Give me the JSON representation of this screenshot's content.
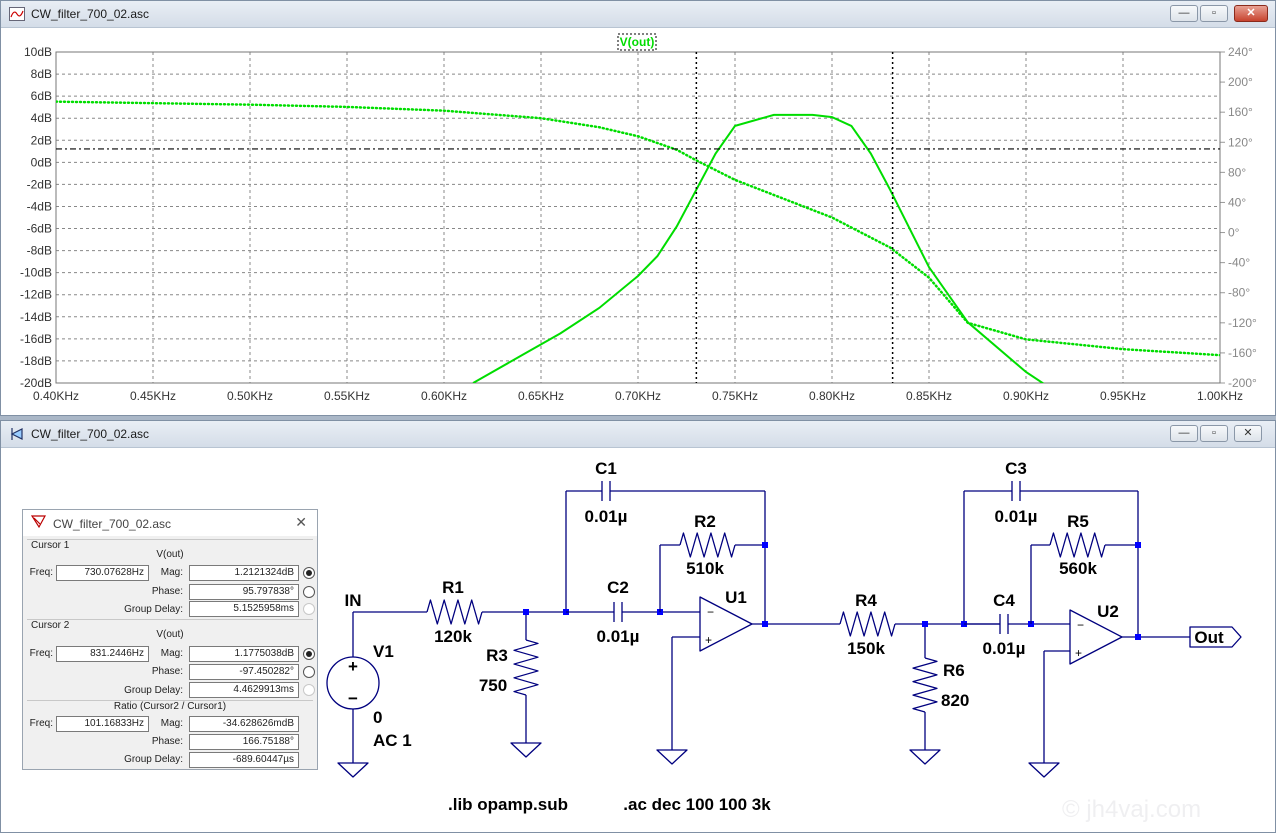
{
  "plot_window": {
    "title": "CW_filter_700_02.asc",
    "trace_label": "V(out)",
    "colors": {
      "trace": "#00dd00",
      "cursor": "#000000"
    },
    "chart_data": {
      "type": "line",
      "x_unit": "KHz",
      "xlim": [
        0.4,
        1.0
      ],
      "x_ticks": [
        "0.40KHz",
        "0.45KHz",
        "0.50KHz",
        "0.55KHz",
        "0.60KHz",
        "0.65KHz",
        "0.70KHz",
        "0.75KHz",
        "0.80KHz",
        "0.85KHz",
        "0.90KHz",
        "0.95KHz",
        "1.00KHz"
      ],
      "y_left_ticks": [
        "10dB",
        "8dB",
        "6dB",
        "4dB",
        "2dB",
        "0dB",
        "-2dB",
        "-4dB",
        "-6dB",
        "-8dB",
        "-10dB",
        "-12dB",
        "-14dB",
        "-16dB",
        "-18dB",
        "-20dB"
      ],
      "y_left_range": [
        -20,
        10
      ],
      "y_right_ticks": [
        "240°",
        "200°",
        "160°",
        "120°",
        "80°",
        "40°",
        "0°",
        "-40°",
        "-80°",
        "-120°",
        "-160°",
        "-200°"
      ],
      "y_right_range": [
        -200,
        240
      ],
      "grid": true,
      "series": [
        {
          "name": "V(out)",
          "style": "solid",
          "axis": "magnitude",
          "x": [
            0.615,
            0.64,
            0.66,
            0.68,
            0.7,
            0.71,
            0.72,
            0.73,
            0.74,
            0.75,
            0.77,
            0.79,
            0.8,
            0.81,
            0.82,
            0.83,
            0.85,
            0.87,
            0.9,
            0.93,
            0.96,
            0.99,
            1.0
          ],
          "y": [
            -20,
            -17.5,
            -15.5,
            -13.2,
            -10.3,
            -8.5,
            -5.8,
            -2.5,
            0.8,
            3.3,
            4.3,
            4.3,
            4.1,
            3.3,
            0.8,
            -2.5,
            -9.5,
            -14.5,
            -19,
            -22.5,
            -25.5,
            -28.5,
            -29.5
          ]
        },
        {
          "name": "V(out)",
          "style": "dotted",
          "axis": "phase",
          "x": [
            0.4,
            0.45,
            0.5,
            0.55,
            0.6,
            0.65,
            0.68,
            0.7,
            0.72,
            0.73,
            0.75,
            0.78,
            0.8,
            0.83,
            0.85,
            0.87,
            0.9,
            0.95,
            1.0
          ],
          "y": [
            174,
            172,
            170,
            167,
            162,
            152,
            140,
            128,
            110,
            96,
            70,
            40,
            20,
            -20,
            -60,
            -120,
            -142,
            -155,
            -163
          ]
        }
      ],
      "cursors": [
        {
          "x": 0.73007628,
          "magnitude_db": 1.2121324
        },
        {
          "x": 0.8312446,
          "magnitude_db": 1.1775038
        }
      ]
    }
  },
  "schematic_window": {
    "title": "CW_filter_700_02.asc",
    "colors": {
      "wire": "#00007f",
      "node": "#0000ff",
      "text": "#000000"
    },
    "labels": {
      "in": "IN",
      "v1": "V1",
      "v1_val": "0",
      "v1_ac": "AC 1",
      "r1": "R1",
      "r1_val": "120k",
      "r3": "R3",
      "r3_val": "750",
      "c1": "C1",
      "c1_val": "0.01µ",
      "c2": "C2",
      "c2_val": "0.01µ",
      "r2": "R2",
      "r2_val": "510k",
      "u1": "U1",
      "r4": "R4",
      "r4_val": "150k",
      "r6": "R6",
      "r6_val": "820",
      "c3": "C3",
      "c3_val": "0.01µ",
      "c4": "C4",
      "c4_val": "0.01µ",
      "r5": "R5",
      "r5_val": "560k",
      "u2": "U2",
      "out": "Out",
      "lib": ".lib opamp.sub",
      "ac": ".ac dec 100 100 3k"
    }
  },
  "cursor_dialog": {
    "title": "CW_filter_700_02.asc",
    "cursor1": {
      "section": "Cursor 1",
      "trace": "V(out)",
      "freq_label": "Freq:",
      "freq": "730.07628Hz",
      "mag_label": "Mag:",
      "mag": "1.2121324dB",
      "phase_label": "Phase:",
      "phase": "95.797838°",
      "gd_label": "Group Delay:",
      "gd": "5.1525958ms"
    },
    "cursor2": {
      "section": "Cursor 2",
      "trace": "V(out)",
      "freq_label": "Freq:",
      "freq": "831.2446Hz",
      "mag_label": "Mag:",
      "mag": "1.1775038dB",
      "phase_label": "Phase:",
      "phase": "-97.450282°",
      "gd_label": "Group Delay:",
      "gd": "4.4629913ms"
    },
    "ratio": {
      "section": "Ratio (Cursor2 / Cursor1)",
      "freq_label": "Freq:",
      "freq": "101.16833Hz",
      "mag_label": "Mag:",
      "mag": "-34.628626mdB",
      "phase_label": "Phase:",
      "phase": "166.75188°",
      "gd_label": "Group Delay:",
      "gd": "-689.60447µs"
    }
  },
  "watermark": "© jh4vaj.com"
}
